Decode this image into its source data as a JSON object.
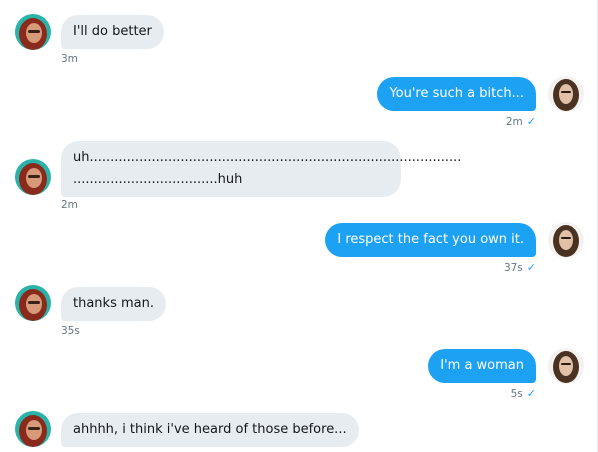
{
  "messages": [
    {
      "side": "in",
      "text": "I'll do better",
      "time": "3m"
    },
    {
      "side": "out",
      "text": "You're such a bitch...",
      "time": "2m"
    },
    {
      "side": "in",
      "lines": [
        "uh..........................................................................................",
        "...................................huh"
      ],
      "time": "2m"
    },
    {
      "side": "out",
      "text": "I respect the fact you own it.",
      "time": "37s"
    },
    {
      "side": "in",
      "text": "thanks man.",
      "time": "35s"
    },
    {
      "side": "out",
      "text": "I'm a woman",
      "time": "5s"
    },
    {
      "side": "in",
      "text": "ahhhh, i think i've heard of those before..."
    }
  ],
  "colors": {
    "outgoing_bubble": "#1da1f2",
    "incoming_bubble": "#e6ecf0",
    "read_check": "#1da1f2",
    "timestamp": "#657786"
  },
  "icons": {
    "read_receipt": "check-icon"
  }
}
